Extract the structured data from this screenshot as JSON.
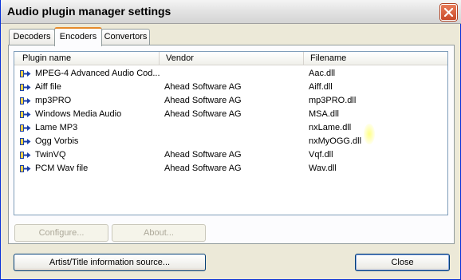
{
  "window": {
    "title": "Audio plugin manager settings"
  },
  "tabs": [
    {
      "label": "Decoders"
    },
    {
      "label": "Encoders"
    },
    {
      "label": "Convertors"
    }
  ],
  "list": {
    "columns": [
      "Plugin name",
      "Vendor",
      "Filename"
    ],
    "rows": [
      {
        "name": "MPEG-4 Advanced Audio Cod...",
        "vendor": "",
        "file": "Aac.dll"
      },
      {
        "name": "Aiff file",
        "vendor": "Ahead Software AG",
        "file": "Aiff.dll"
      },
      {
        "name": "mp3PRO",
        "vendor": "Ahead Software AG",
        "file": "mp3PRO.dll"
      },
      {
        "name": "Windows Media Audio",
        "vendor": "Ahead Software AG",
        "file": "MSA.dll"
      },
      {
        "name": "Lame MP3",
        "vendor": "",
        "file": "nxLame.dll"
      },
      {
        "name": "Ogg Vorbis",
        "vendor": "",
        "file": "nxMyOGG.dll"
      },
      {
        "name": "TwinVQ",
        "vendor": "Ahead Software AG",
        "file": "Vqf.dll"
      },
      {
        "name": "PCM Wav file",
        "vendor": "Ahead Software AG",
        "file": "Wav.dll"
      }
    ]
  },
  "buttons": {
    "configure": "Configure...",
    "about": "About...",
    "artist_title": "Artist/Title information source...",
    "close": "Close"
  },
  "icons": {
    "plugin": "plugin-arrow-icon",
    "close": "close-icon"
  },
  "colors": {
    "active_tab_accent": "#e68b2c",
    "plugin_icon": "#1a3fa8"
  }
}
